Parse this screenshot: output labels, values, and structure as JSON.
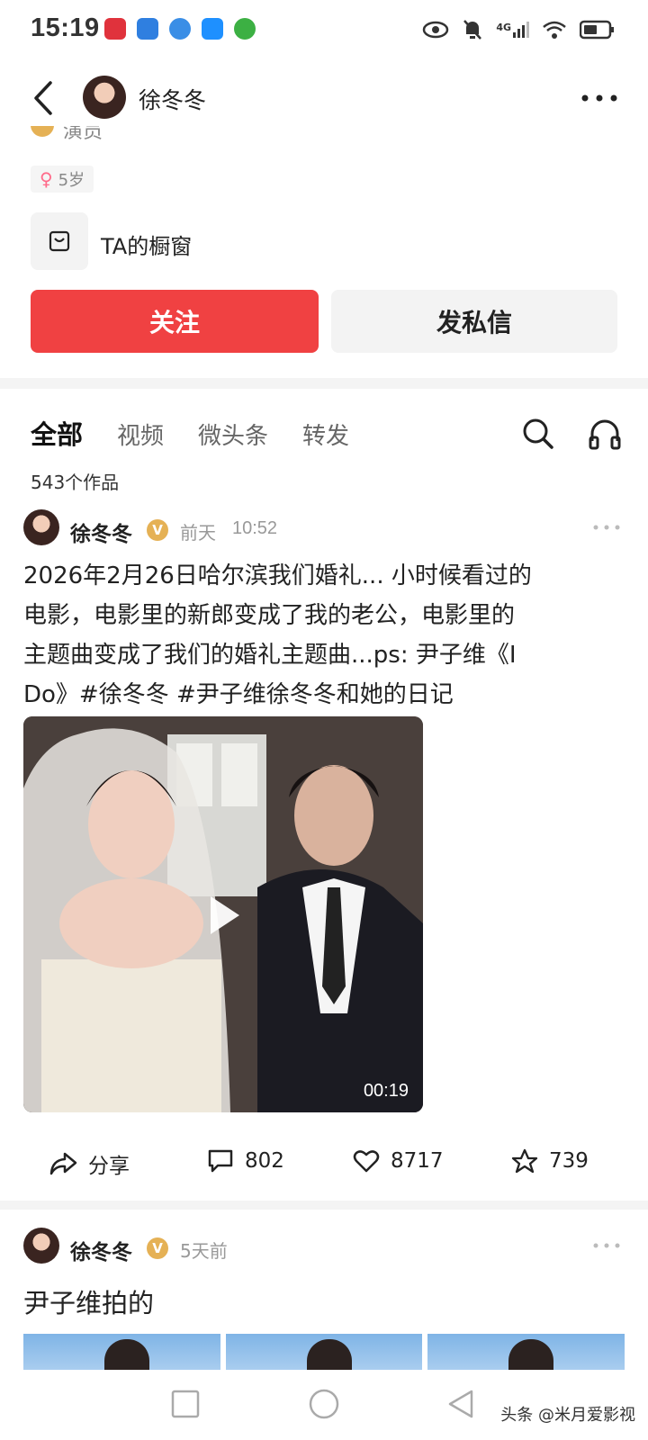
{
  "status_bar": {
    "time": "15:19",
    "network": "4G"
  },
  "header": {
    "name": "徐冬冬"
  },
  "profile": {
    "verified_text": "演员",
    "gender_age": "5岁",
    "shop_label": "TA的橱窗",
    "follow_label": "关注",
    "message_label": "发私信"
  },
  "tabs": [
    {
      "label": "全部",
      "active": true
    },
    {
      "label": "视频",
      "active": false
    },
    {
      "label": "微头条",
      "active": false
    },
    {
      "label": "转发",
      "active": false
    }
  ],
  "works_count": "543个作品",
  "post1": {
    "author": "徐冬冬",
    "badge": "V",
    "day": "前天",
    "time": "10:52",
    "line1": "2026年2月26日哈尔滨我们婚礼... 小时候看过的",
    "line2": "电影，电影里的新郎变成了我的老公，电影里的",
    "line3": "主题曲变成了我们的婚礼主题曲...ps: 尹子维《I",
    "line4": "Do》#徐冬冬 #尹子维徐冬冬和她的日记",
    "video_duration": "00:19",
    "share_label": "分享",
    "comments": "802",
    "likes": "8717",
    "favorites": "739"
  },
  "post2": {
    "author": "徐冬冬",
    "badge": "V",
    "time": "5天前",
    "text": "尹子维拍的"
  },
  "watermark": "头条 @米月爱影视",
  "colors": {
    "accent": "#f04142",
    "badge": "#e5b155"
  }
}
